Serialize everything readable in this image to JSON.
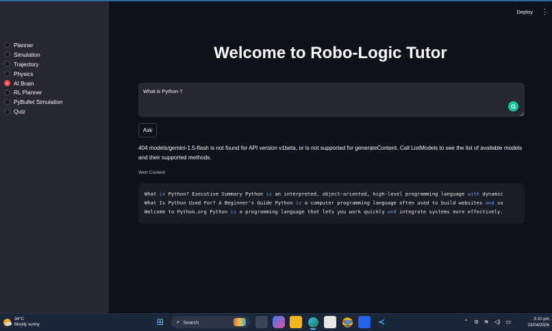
{
  "sidebar": {
    "items": [
      {
        "label": "Planner",
        "selected": false
      },
      {
        "label": "Simulation",
        "selected": false
      },
      {
        "label": "Trajectory",
        "selected": false
      },
      {
        "label": "Physics",
        "selected": false
      },
      {
        "label": "AI Brain",
        "selected": true
      },
      {
        "label": "RL Planner",
        "selected": false
      },
      {
        "label": "PyBullet Simulation",
        "selected": false
      },
      {
        "label": "Quiz",
        "selected": false
      }
    ]
  },
  "header": {
    "deploy_label": "Deploy",
    "menu_icon": "kebab-menu-icon"
  },
  "main": {
    "title": "Welcome to Robo-Logic Tutor",
    "question_value": "What is Python ?",
    "ask_label": "Ask",
    "error_message": "404 models/gemini-1.5-flash is not found for API version v1beta, or is not supported for generateContent. Call ListModels to see the list of available models and their supported methods.",
    "context_label": "Web Context",
    "context_lines": [
      "What is Python? Executive Summary Python is an interpreted, object-oriented, high-level programming language with dynamic",
      "What Is Python Used For? A Beginner's Guide Python is a computer programming language often used to build websites and so",
      "Welcome to Python.org Python is a programming language that lets you work quickly and integrate systems more effectively."
    ]
  },
  "colors": {
    "accent": "#ff4b4b",
    "keyword": "#5b9bf6",
    "background": "#0e1117",
    "sidebar": "#262730"
  },
  "taskbar": {
    "weather_temp": "34°C",
    "weather_desc": "Mostly sunny",
    "search_placeholder": "Search",
    "time": "3:10 pm",
    "date": "23/04/2026"
  }
}
